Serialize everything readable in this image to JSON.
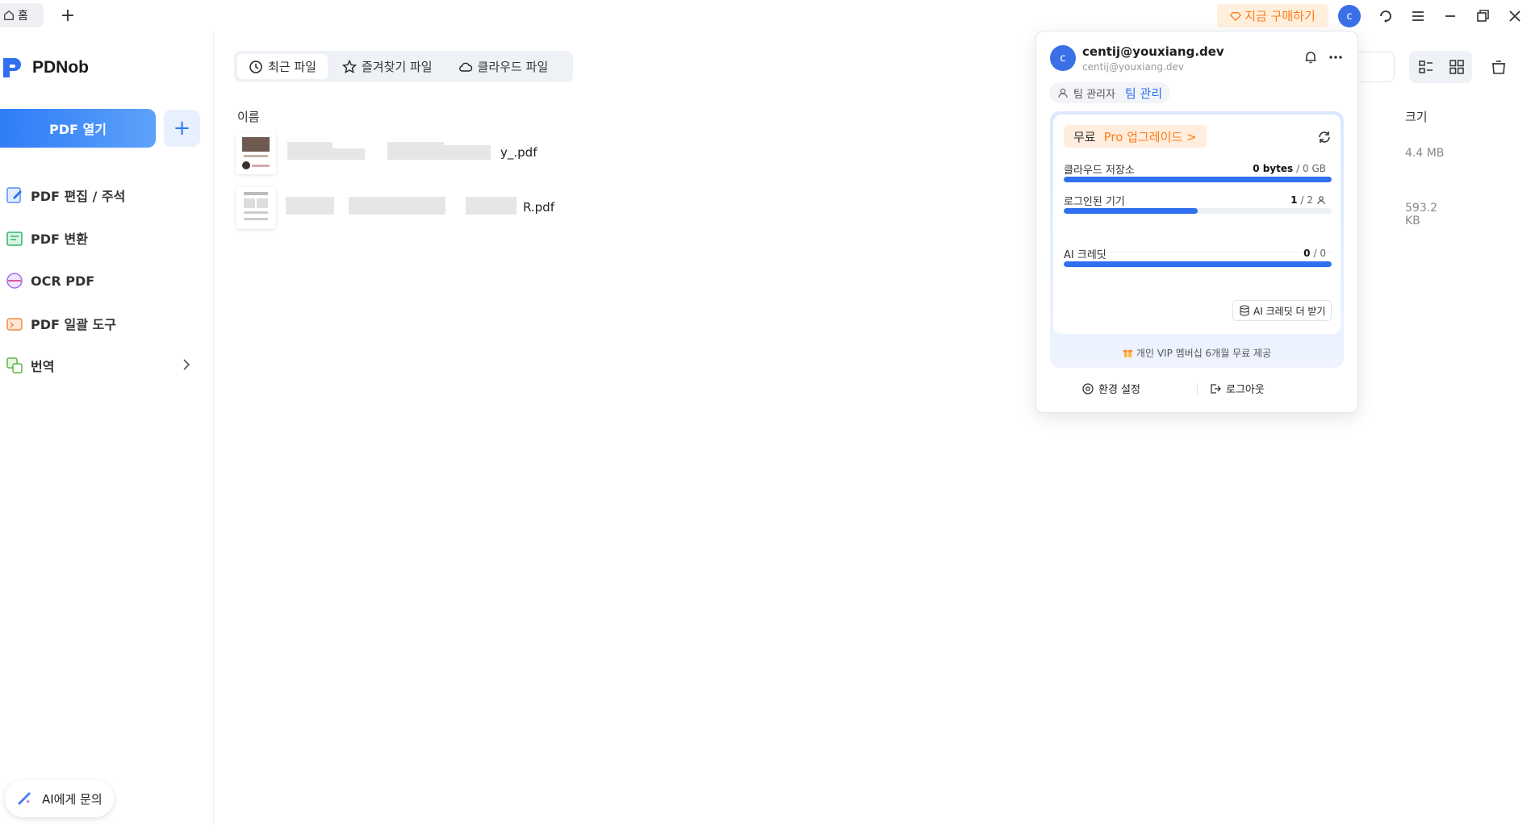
{
  "titlebar": {
    "home_tab": "홈",
    "new_tab": "+",
    "buy_now": "지금 구매하기",
    "avatar_letter": "c"
  },
  "sidebar": {
    "logo": "PDNob",
    "open_pdf": "PDF 열기",
    "add": "+",
    "items": [
      {
        "label": "PDF 편집 / 주석",
        "icon": "edit-icon"
      },
      {
        "label": "PDF 변환",
        "icon": "convert-icon"
      },
      {
        "label": "OCR PDF",
        "icon": "ocr-icon"
      },
      {
        "label": "PDF 일괄 도구",
        "icon": "batch-tools-icon"
      },
      {
        "label": "번역",
        "icon": "translate-icon"
      }
    ],
    "ai_ask": "AI에게 문의"
  },
  "main": {
    "tabs": [
      {
        "label": "최근 파일",
        "icon": "clock-icon",
        "active": true
      },
      {
        "label": "즐겨찾기 파일",
        "icon": "star-icon",
        "active": false
      },
      {
        "label": "클라우드 파일",
        "icon": "cloud-icon",
        "active": false
      }
    ],
    "columns": {
      "name": "이름",
      "size": "크기"
    },
    "files": [
      {
        "name_suffix": "y_.pdf",
        "size": "4.4 MB"
      },
      {
        "name_suffix": "R.pdf",
        "size": "593.2 KB"
      }
    ]
  },
  "popup": {
    "avatar_letter": "c",
    "email": "centij@youxiang.dev",
    "email_sub": "centij@youxiang.dev",
    "team_admin": "팀 관리자",
    "team_manage": "팀 관리",
    "plan_free": "무료",
    "plan_upgrade": "Pro 업그레이드 >",
    "cloud_label": "클라우드 저장소",
    "cloud_used": "0 bytes",
    "cloud_total": "/ 0 GB",
    "cloud_fraction": 1.0,
    "devices_label": "로그인된 기기",
    "devices_used": "1",
    "devices_total": "/ 2",
    "devices_fraction": 0.5,
    "ai_label": "AI 크레딧",
    "ai_used": "0",
    "ai_total": "/ 0",
    "ai_fraction": 1.0,
    "more_credits": "AI 크레딧 더 받기",
    "vip_offer": "개인 VIP 멤버십 6개월 무료 제공",
    "settings": "환경 설정",
    "logout": "로그아웃"
  },
  "colors": {
    "accent": "#2f6ff0",
    "buy_bg": "#fff0dd",
    "buy_text": "#ff7a1a"
  }
}
